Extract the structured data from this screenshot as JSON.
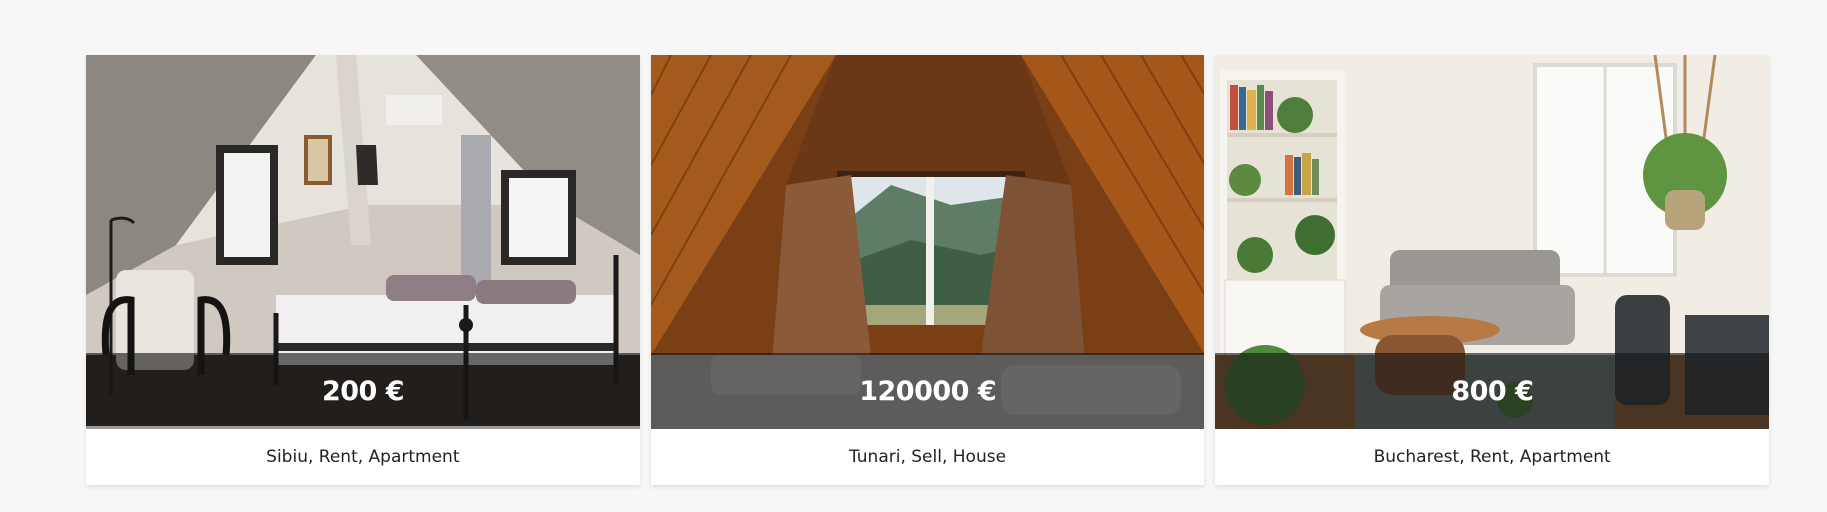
{
  "listings": [
    {
      "price": "200 €",
      "caption": "Sibiu, Rent, Apartment",
      "photo_icon": "attic-bedroom-photo"
    },
    {
      "price": "120000 €",
      "caption": "Tunari, Sell, House",
      "photo_icon": "a-frame-window-photo"
    },
    {
      "price": "800 €",
      "caption": "Bucharest, Rent, Apartment",
      "photo_icon": "living-room-photo"
    }
  ],
  "colors": {
    "page_background": "#f7f7f7",
    "card_background": "#ffffff",
    "price_overlay": "rgba(20,20,20,0.62)",
    "price_text": "#ffffff",
    "caption_text": "#222222"
  }
}
